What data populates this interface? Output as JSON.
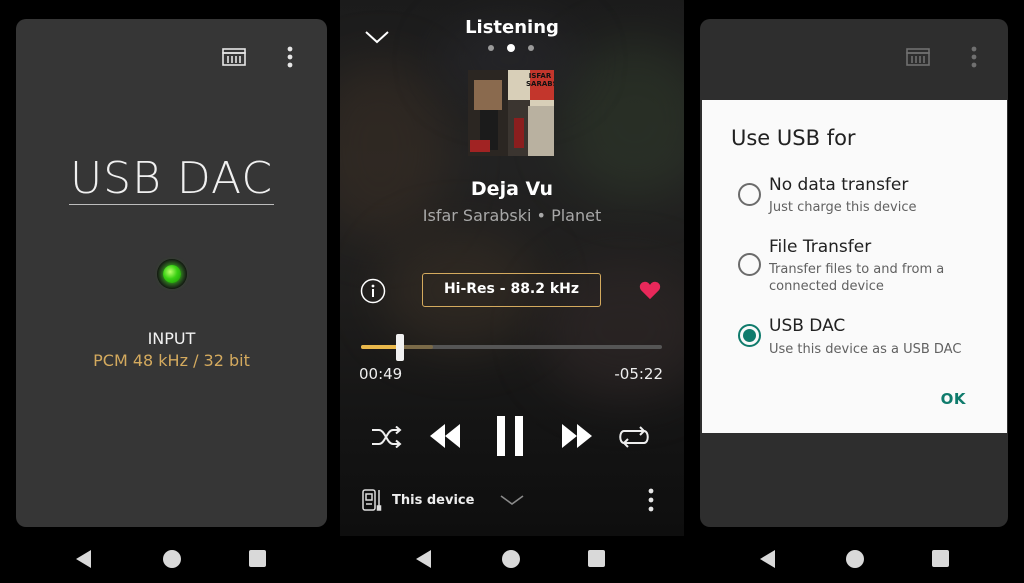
{
  "panel_usb_dac": {
    "title": "USB DAC",
    "input_label": "INPUT",
    "input_value": "PCM 48 kHz / 32 bit",
    "icons": {
      "storage": "storage-icon",
      "menu": "more-vert-icon"
    },
    "led_color": "#39d113",
    "accent": "#d4aa5e"
  },
  "panel_player": {
    "header": "Listening",
    "pager": {
      "count": 3,
      "active": 2
    },
    "track": {
      "title": "Deja Vu",
      "subtitle": "Isfar Sarabski • Planet",
      "cover_text": "ISFAR SARABSKI"
    },
    "quality": "Hi-Res - 88.2 kHz",
    "favorite": true,
    "progress": {
      "played_fraction": 0.13,
      "buffered_fraction": 0.24,
      "elapsed": "00:49",
      "remaining": "-05:22"
    },
    "output_device": "This device",
    "colors": {
      "progress": "#e9b84b",
      "heart": "#e8285a",
      "badge_border": "#d4aa5e"
    }
  },
  "panel_usb_dialog": {
    "title": "Use USB for",
    "options": [
      {
        "title": "No data transfer",
        "desc": "Just charge this device",
        "selected": false
      },
      {
        "title": "File Transfer",
        "desc": "Transfer files to and from a connected device",
        "selected": false
      },
      {
        "title": "USB DAC",
        "desc": "Use this device as a USB DAC",
        "selected": true
      }
    ],
    "ok_label": "OK",
    "accent": "#0f7b6c"
  },
  "navbar": {
    "icons": [
      "back-icon",
      "home-icon",
      "recents-icon"
    ]
  }
}
